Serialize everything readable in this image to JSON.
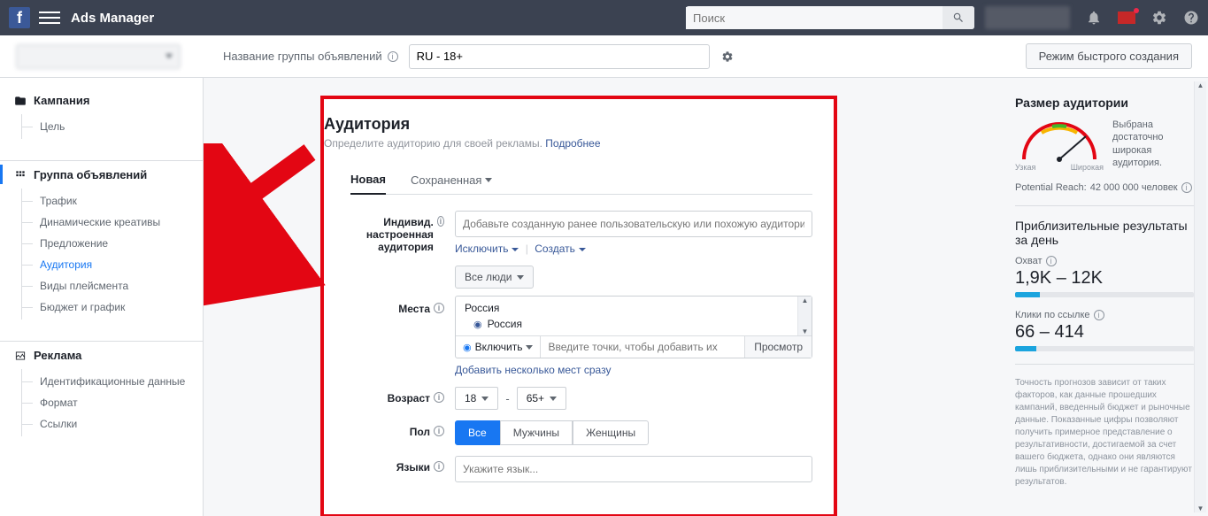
{
  "topbar": {
    "app_title": "Ads Manager",
    "search_placeholder": "Поиск"
  },
  "subheader": {
    "adset_label": "Название группы объявлений",
    "adset_name": "RU - 18+",
    "quick_create": "Режим быстрого создания"
  },
  "sidebar": {
    "campaign": {
      "title": "Кампания",
      "items": [
        "Цель"
      ]
    },
    "adset": {
      "title": "Группа объявлений",
      "items": [
        "Трафик",
        "Динамические креативы",
        "Предложение",
        "Аудитория",
        "Виды плейсмента",
        "Бюджет и график"
      ],
      "active_index": 3
    },
    "ad": {
      "title": "Реклама",
      "items": [
        "Идентификационные данные",
        "Формат",
        "Ссылки"
      ]
    }
  },
  "audience": {
    "title": "Аудитория",
    "subtitle": "Определите аудиторию для своей рекламы. ",
    "learn_more": "Подробнее",
    "tab_new": "Новая",
    "tab_saved": "Сохраненная",
    "custom_label": "Индивид. настроенная аудитория",
    "custom_placeholder": "Добавьте созданную ранее пользовательскую или похожую аудиторию",
    "exclude": "Исключить",
    "create": "Создать",
    "places_label": "Места",
    "people_dd": "Все люди",
    "country": "Россия",
    "selected_country": "Россия",
    "include": "Включить",
    "loc_placeholder": "Введите точки, чтобы добавить их",
    "view": "Просмотр",
    "add_multi": "Добавить несколько мест сразу",
    "age_label": "Возраст",
    "age_min": "18",
    "age_max": "65+",
    "gender_label": "Пол",
    "gender_all": "Все",
    "gender_m": "Мужчины",
    "gender_f": "Женщины",
    "lang_label": "Языки",
    "lang_placeholder": "Укажите язык..."
  },
  "right": {
    "size_title": "Размер аудитории",
    "gauge_text": "Выбрана достаточно широкая аудитория.",
    "gauge_narrow": "Узкая",
    "gauge_broad": "Широкая",
    "reach_label": "Potential Reach:",
    "reach_value": "42 000 000 человек",
    "est_title": "Приблизительные результаты за день",
    "cov_label": "Охват",
    "cov_value": "1,9K – 12K",
    "clk_label": "Клики по ссылке",
    "clk_value": "66 – 414",
    "disclaimer": "Точность прогнозов зависит от таких факторов, как данные прошедших кампаний, введенный бюджет и рыночные данные. Показанные цифры позволяют получить примерное представление о результативности, достигаемой за счет вашего бюджета, однако они являются лишь приблизительными и не гарантируют результатов."
  }
}
